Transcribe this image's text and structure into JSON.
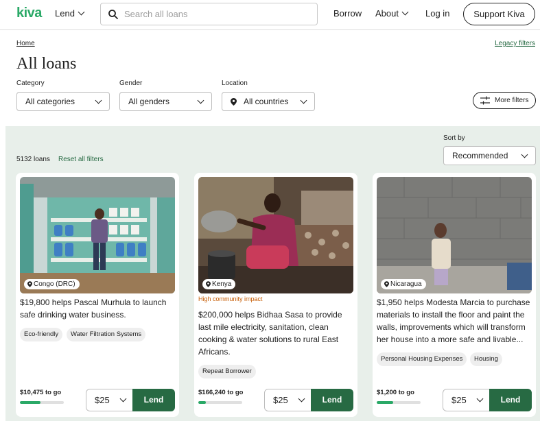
{
  "header": {
    "logo": "kiva",
    "lend": "Lend",
    "search_placeholder": "Search all loans",
    "borrow": "Borrow",
    "about": "About",
    "login": "Log in",
    "support": "Support Kiva"
  },
  "breadcrumb": {
    "home": "Home",
    "legacy": "Legacy filters"
  },
  "page_title": "All loans",
  "filters": {
    "category": {
      "label": "Category",
      "value": "All categories"
    },
    "gender": {
      "label": "Gender",
      "value": "All genders"
    },
    "location": {
      "label": "Location",
      "value": "All countries"
    },
    "more": "More filters"
  },
  "results": {
    "count": "5132 loans",
    "reset": "Reset all filters",
    "sort_label": "Sort by",
    "sort_value": "Recommended"
  },
  "cards": [
    {
      "country": "Congo (DRC)",
      "impact": "",
      "description": "$19,800 helps Pascal Murhula to launch safe drinking water business.",
      "tags": [
        "Eco-friendly",
        "Water Filtration Systems"
      ],
      "to_go": "$10,475 to go",
      "progress": 0.47,
      "amount": "$25",
      "lend": "Lend"
    },
    {
      "country": "Kenya",
      "impact": "High community impact",
      "description": "$200,000 helps Bidhaa Sasa to provide last mile electricity, sanitation, clean cooking & water solutions to rural East Africans.",
      "tags": [
        "Repeat Borrower"
      ],
      "to_go": "$166,240 to go",
      "progress": 0.17,
      "amount": "$25",
      "lend": "Lend"
    },
    {
      "country": "Nicaragua",
      "impact": "",
      "description": "$1,950 helps Modesta Marcia to purchase materials to install the floor and paint the walls, improvements which will transform her house into a more safe and livable...",
      "tags": [
        "Personal Housing Expenses",
        "Housing"
      ],
      "to_go": "$1,200 to go",
      "progress": 0.38,
      "amount": "$25",
      "lend": "Lend"
    }
  ],
  "colors": {
    "brand": "#2aa967",
    "lend_button": "#276a43",
    "impact": "#c65a00",
    "results_bg": "#e8efea"
  }
}
